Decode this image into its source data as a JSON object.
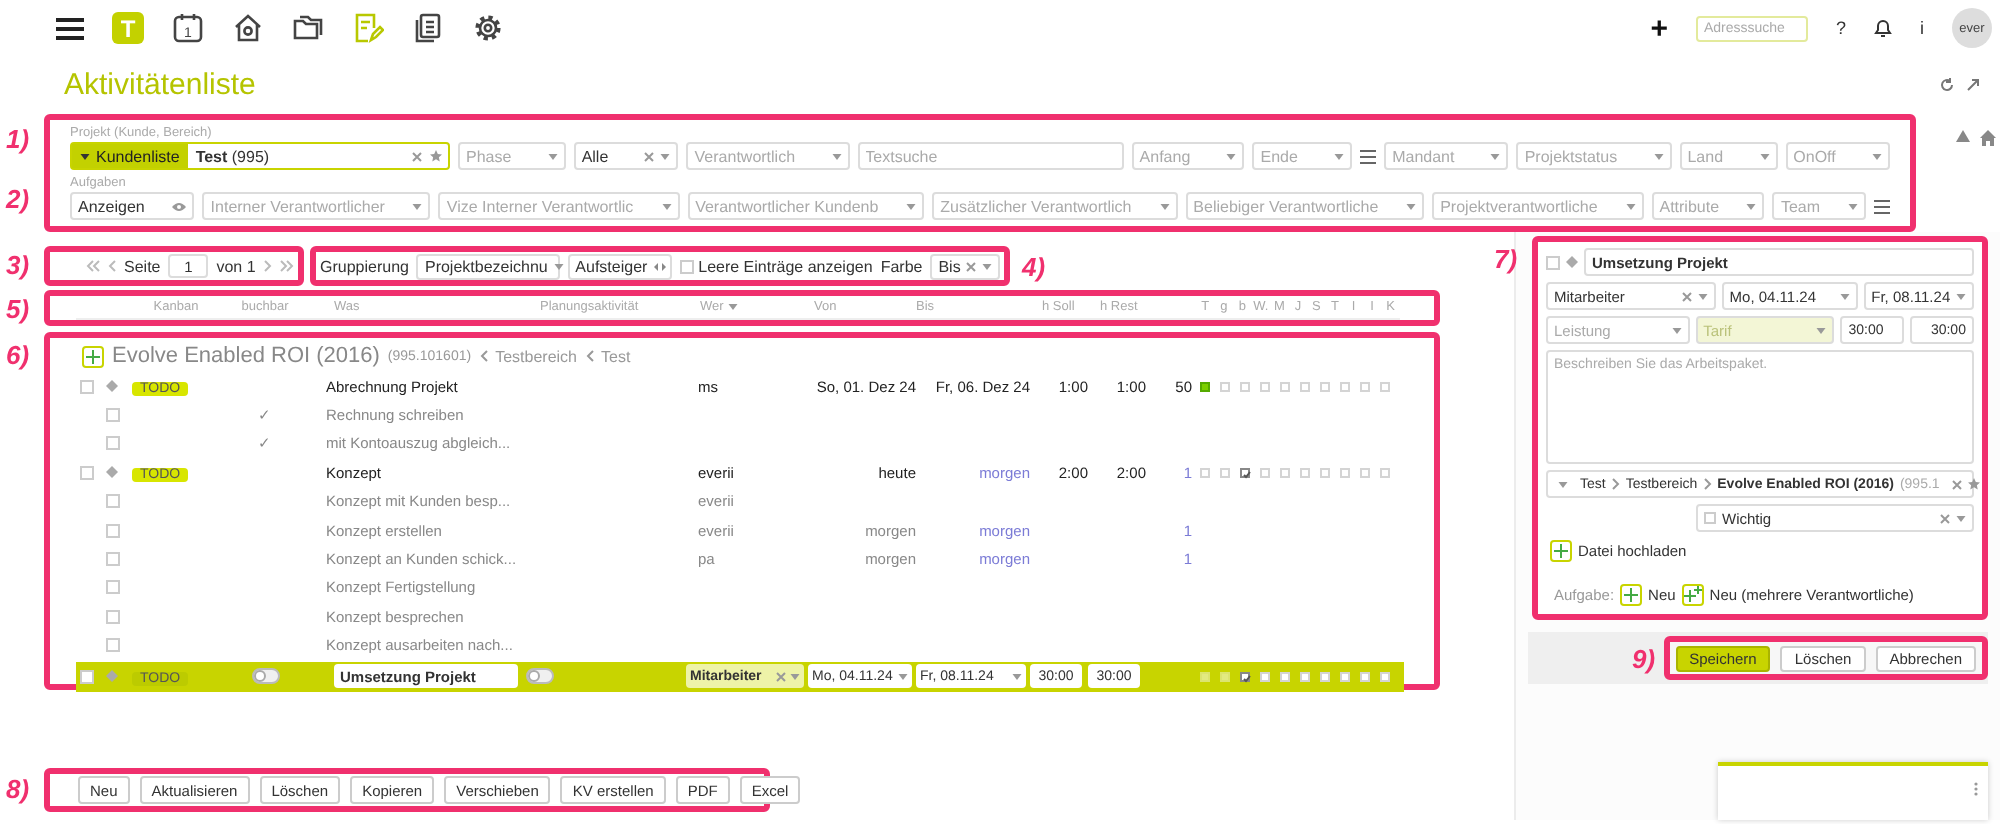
{
  "topbar": {
    "logo": "T",
    "nav": [
      {
        "kind": "calendar",
        "glyph": "1",
        "selected": false
      },
      {
        "kind": "home",
        "selected": false
      },
      {
        "kind": "folders",
        "selected": false
      },
      {
        "kind": "tasks",
        "selected": true
      },
      {
        "kind": "documents",
        "selected": false
      },
      {
        "kind": "settings",
        "selected": false
      }
    ],
    "add": "+",
    "search": {
      "placeholder": "Adresssuche"
    },
    "help": "?",
    "info": "i",
    "avatar": "ever"
  },
  "page": {
    "title": "Aktivitätenliste"
  },
  "filters": {
    "callouts": [
      "1)",
      "2)"
    ],
    "project_label": "Projekt (Kunde, Bereich)",
    "project_button": "Kundenliste",
    "project_value": "**Test** (995)",
    "row1": [
      {
        "kind": "select",
        "placeholder": "Phase"
      },
      {
        "kind": "select",
        "value": "Alle",
        "clearable": true
      },
      {
        "kind": "select",
        "placeholder": "Verantwortlich"
      },
      {
        "kind": "text",
        "placeholder": "Textsuche"
      },
      {
        "kind": "select",
        "placeholder": "Anfang"
      },
      {
        "kind": "select",
        "placeholder": "Ende"
      },
      {
        "kind": "menu"
      },
      {
        "kind": "select",
        "placeholder": "Mandant"
      },
      {
        "kind": "select",
        "placeholder": "Projektstatus"
      },
      {
        "kind": "select",
        "placeholder": "Land"
      },
      {
        "kind": "select",
        "placeholder": "OnOff"
      }
    ],
    "tasks_label": "Aufgaben",
    "row2": [
      {
        "kind": "toggle",
        "value": "Anzeigen"
      },
      {
        "kind": "select",
        "placeholder": "Interner Verantwortlicher"
      },
      {
        "kind": "select",
        "placeholder": "Vize Interner Verantwortlic"
      },
      {
        "kind": "select",
        "placeholder": "Verantwortlicher Kundenb"
      },
      {
        "kind": "select",
        "placeholder": "Zusätzlicher Verantwortlich"
      },
      {
        "kind": "select",
        "placeholder": "Beliebiger Verantwortliche"
      },
      {
        "kind": "select",
        "placeholder": "Projektverantwortliche"
      },
      {
        "kind": "select",
        "placeholder": "Attribute"
      },
      {
        "kind": "select",
        "placeholder": "Team"
      },
      {
        "kind": "menu"
      }
    ]
  },
  "list_toolbar": {
    "callouts": [
      "3)",
      "4)"
    ],
    "pager": {
      "label": "Seite",
      "page": "1",
      "total": "von 1"
    },
    "grouping": {
      "label": "Gruppierung",
      "value": "Projektbezeichnu",
      "order": "Aufsteiger",
      "empty_entries": {
        "label": "Leere Einträge anzeigen",
        "checked": false
      },
      "color_label": "Farbe",
      "color_value": "Bis"
    }
  },
  "header": {
    "callout": "5)",
    "columns": [
      {
        "label": "Kanban",
        "sorted": false
      },
      {
        "label": "buchbar",
        "sorted": false
      },
      {
        "label": "Was",
        "sorted": false
      },
      {
        "label": "Planungsaktivität",
        "sorted": false
      },
      {
        "label": "Wer",
        "sorted": true
      },
      {
        "label": "Von",
        "sorted": false
      },
      {
        "label": "Bis",
        "sorted": false
      },
      {
        "label": "h Soll",
        "sorted": false
      },
      {
        "label": "h Rest",
        "sorted": false
      }
    ],
    "days": [
      "T",
      "g",
      "b",
      "W.",
      "M",
      "J",
      "S",
      "T",
      "I",
      "I",
      "K"
    ]
  },
  "table": {
    "callout": "6)",
    "group": {
      "title": "Evolve Enabled ROI (2016)",
      "code": "(995.101601)",
      "path": [
        "Testbereich",
        "Test"
      ]
    },
    "rows": [
      {
        "kind": "task",
        "checked": false,
        "tag": "TODO",
        "was": "Abrechnung Projekt",
        "wer": "ms",
        "von": "So, 01. Dez 24",
        "bis": "Fr, 06. Dez 24",
        "bis_relative": false,
        "soll": "1:00",
        "rest": "1:00",
        "count": "50",
        "count_link": false,
        "days": [
          {
            "filled": true,
            "checked": false
          },
          {
            "filled": false,
            "checked": false
          },
          {
            "filled": false,
            "checked": false
          },
          {
            "filled": false,
            "checked": false
          },
          {
            "filled": false,
            "checked": false
          },
          {
            "filled": false,
            "checked": false
          },
          {
            "filled": false,
            "checked": false
          },
          {
            "filled": false,
            "checked": false
          },
          {
            "filled": false,
            "checked": false
          },
          {
            "filled": false,
            "checked": false
          }
        ]
      },
      {
        "kind": "subtask",
        "checked": false,
        "buchbar": "✓",
        "was": "Rechnung schreiben"
      },
      {
        "kind": "subtask",
        "checked": false,
        "buchbar": "✓",
        "was": "mit Kontoauszug abgleich..."
      },
      {
        "kind": "task",
        "checked": false,
        "tag": "TODO",
        "was": "Konzept",
        "wer": "everii",
        "von": "heute",
        "bis": "morgen",
        "bis_relative": true,
        "soll": "2:00",
        "rest": "2:00",
        "count": "1",
        "count_link": true,
        "days": [
          {
            "filled": false,
            "checked": false
          },
          {
            "filled": false,
            "checked": false
          },
          {
            "filled": false,
            "checked": true
          },
          {
            "filled": false,
            "checked": false
          },
          {
            "filled": false,
            "checked": false
          },
          {
            "filled": false,
            "checked": false
          },
          {
            "filled": false,
            "checked": false
          },
          {
            "filled": false,
            "checked": false
          },
          {
            "filled": false,
            "checked": false
          },
          {
            "filled": false,
            "checked": false
          }
        ]
      },
      {
        "kind": "subtask",
        "checked": false,
        "was": "Konzept mit Kunden besp...",
        "wer": "everii"
      },
      {
        "kind": "subtask",
        "checked": false,
        "was": "Konzept erstellen",
        "wer": "everii",
        "von": "morgen",
        "bis": "morgen",
        "bis_relative": true,
        "count": "1",
        "count_link": true
      },
      {
        "kind": "subtask",
        "checked": false,
        "was": "Konzept an Kunden schick...",
        "wer": "pa",
        "von": "morgen",
        "bis": "morgen",
        "bis_relative": true,
        "count": "1",
        "count_link": true
      },
      {
        "kind": "subtask",
        "checked": false,
        "was": "Konzept Fertigstellung"
      },
      {
        "kind": "subtask",
        "checked": false,
        "was": "Konzept besprechen"
      },
      {
        "kind": "subtask",
        "checked": false,
        "was": "Konzept ausarbeiten nach..."
      },
      {
        "kind": "edit",
        "checked": false,
        "tag": "TODO",
        "buchbar_on": false,
        "was": "Umsetzung Projekt",
        "planned_on": false,
        "wer": "Mitarbeiter",
        "von": "Mo, 04.11.24",
        "bis": "Fr, 08.11.24",
        "soll": "30:00",
        "rest": "30:00",
        "days": [
          {
            "filled": true,
            "checked": false
          },
          {
            "filled": true,
            "checked": false
          },
          {
            "filled": false,
            "checked": true
          },
          {
            "filled": false,
            "checked": false
          },
          {
            "filled": false,
            "checked": false
          },
          {
            "filled": false,
            "checked": false
          },
          {
            "filled": false,
            "checked": false
          },
          {
            "filled": false,
            "checked": false
          },
          {
            "filled": false,
            "checked": false
          },
          {
            "filled": false,
            "checked": false
          }
        ]
      }
    ]
  },
  "detail": {
    "callout": "7)",
    "checked": false,
    "title": "Umsetzung Projekt",
    "assignee": "Mitarbeiter",
    "start": "Mo, 04.11.24",
    "end": "Fr, 08.11.24",
    "service": {
      "placeholder": "Leistung"
    },
    "rate": {
      "placeholder": "Tarif"
    },
    "planned": "30:00",
    "remaining": "30:00",
    "description": {
      "placeholder": "Beschreiben Sie das Arbeitspaket."
    },
    "project": {
      "path": [
        "Test",
        "Testbereich"
      ],
      "name": "Evolve Enabled ROI (2016)",
      "code": "(995.1"
    },
    "priority": {
      "value": "Wichtig",
      "checked": false
    },
    "upload": "Datei hochladen",
    "task_label": "Aufgabe:",
    "new": "Neu",
    "new_multi": "Neu (mehrere Verantwortliche)"
  },
  "actions": {
    "callout": "9)",
    "buttons": [
      {
        "label": "Speichern",
        "primary": true
      },
      {
        "label": "Löschen",
        "primary": false
      },
      {
        "label": "Abbrechen",
        "primary": false
      }
    ]
  },
  "bottom_toolbar": {
    "callout": "8)",
    "buttons": [
      "Neu",
      "Aktualisieren",
      "Löschen",
      "Kopieren",
      "Verschieben",
      "KV erstellen",
      "PDF",
      "Excel"
    ]
  }
}
